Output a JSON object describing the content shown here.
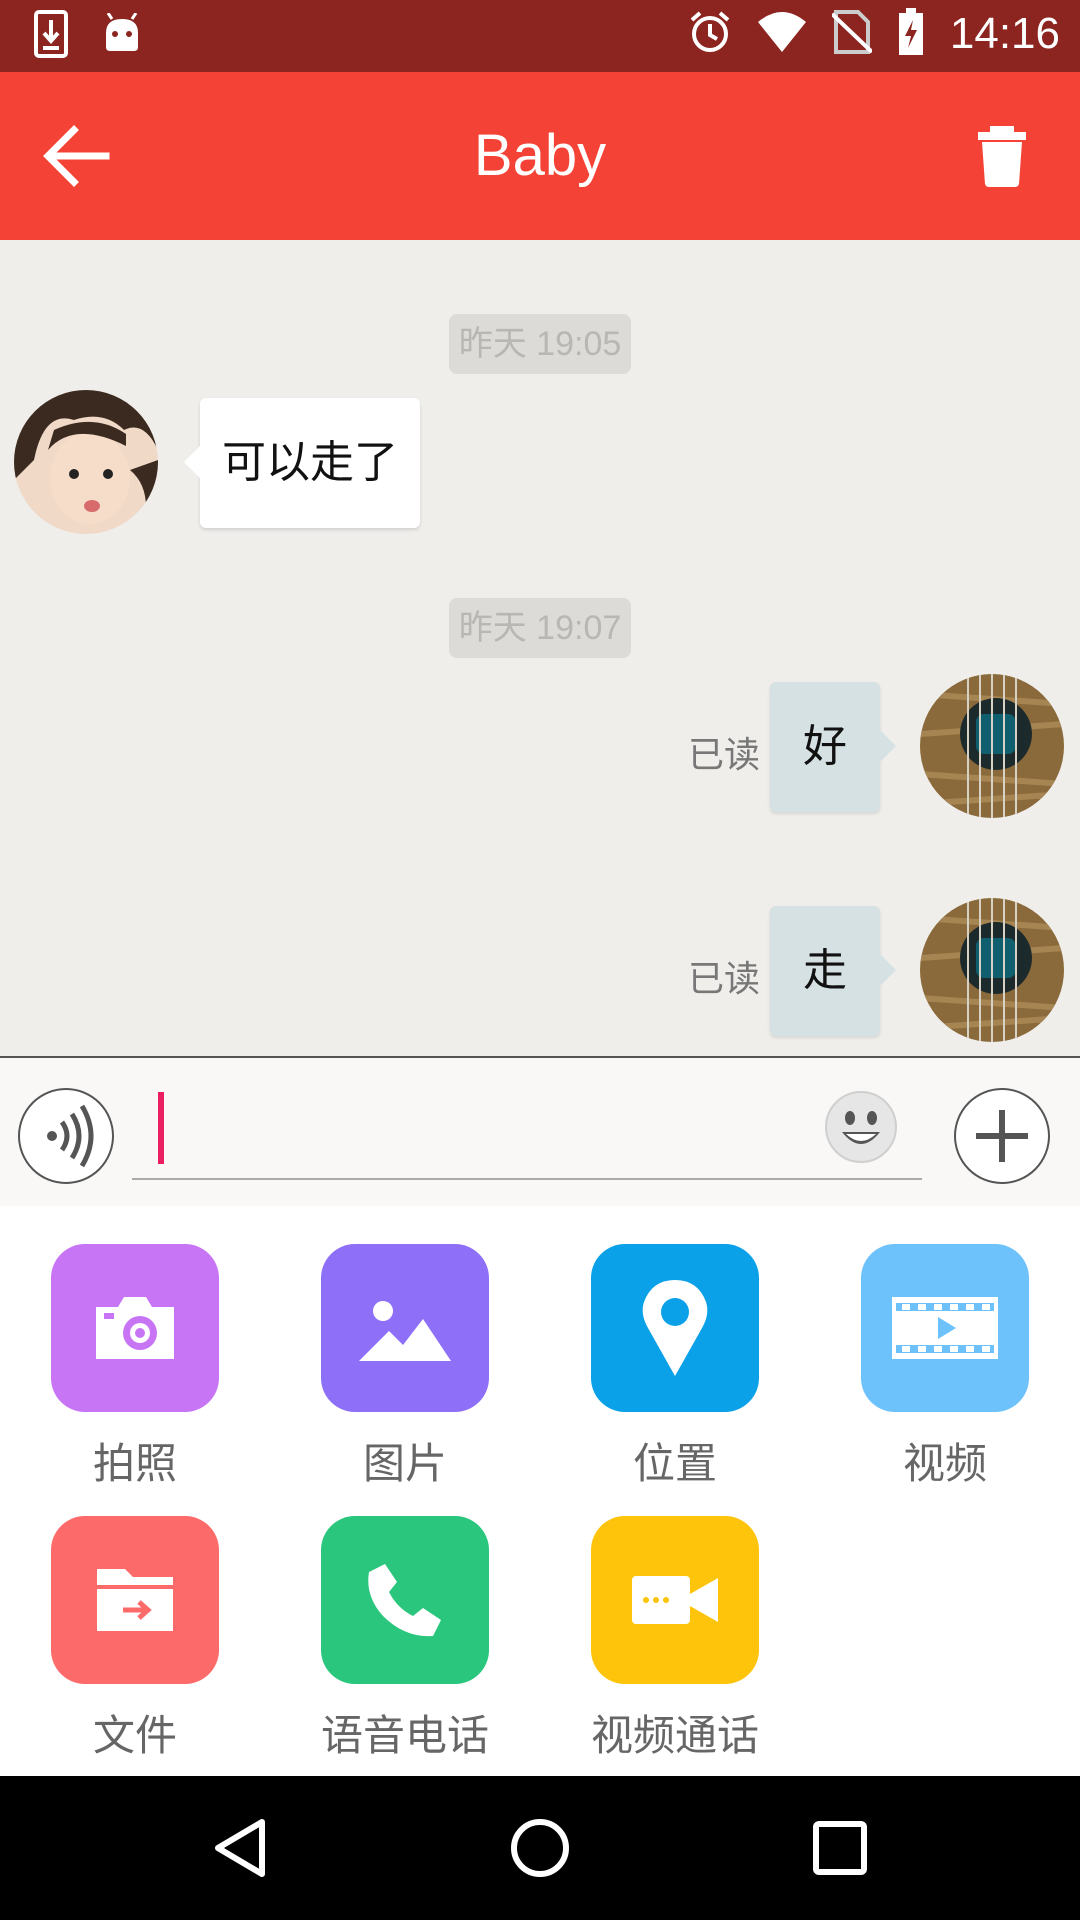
{
  "status_bar": {
    "time": "14:16",
    "icons": [
      "download-icon",
      "android-icon",
      "alarm-icon",
      "wifi-icon",
      "no-sim-icon",
      "battery-charging-icon"
    ]
  },
  "app_bar": {
    "title": "Baby",
    "back_icon": "arrow-back-icon",
    "delete_icon": "trash-icon"
  },
  "chat": {
    "messages": [
      {
        "type": "timestamp",
        "text": "昨天 19:05"
      },
      {
        "type": "incoming",
        "text": "可以走了"
      },
      {
        "type": "timestamp",
        "text": "昨天 19:07"
      },
      {
        "type": "outgoing",
        "text": "好",
        "status": "已读"
      },
      {
        "type": "outgoing",
        "text": "走",
        "status": "已读"
      }
    ]
  },
  "input": {
    "value": "",
    "placeholder": "",
    "voice_icon": "voice-icon",
    "emoji_icon": "emoji-icon",
    "plus_icon": "plus-icon"
  },
  "tools": [
    {
      "label": "拍照",
      "icon": "camera-icon",
      "color": "#c774f5"
    },
    {
      "label": "图片",
      "icon": "image-icon",
      "color": "#8e6ff7"
    },
    {
      "label": "位置",
      "icon": "location-icon",
      "color": "#0aa1e8"
    },
    {
      "label": "视频",
      "icon": "film-icon",
      "color": "#6ec2fb"
    },
    {
      "label": "文件",
      "icon": "folder-icon",
      "color": "#fc6a6a"
    },
    {
      "label": "语音电话",
      "icon": "phone-icon",
      "color": "#2ac67d"
    },
    {
      "label": "视频通话",
      "icon": "video-call-icon",
      "color": "#fec40b"
    }
  ],
  "colors": {
    "status_bar": "#8c2520",
    "app_bar": "#f44336",
    "chat_bg": "#efeeeb",
    "incoming_bubble": "#ffffff",
    "outgoing_bubble": "#d5e1e3",
    "cursor": "#e91e63"
  }
}
